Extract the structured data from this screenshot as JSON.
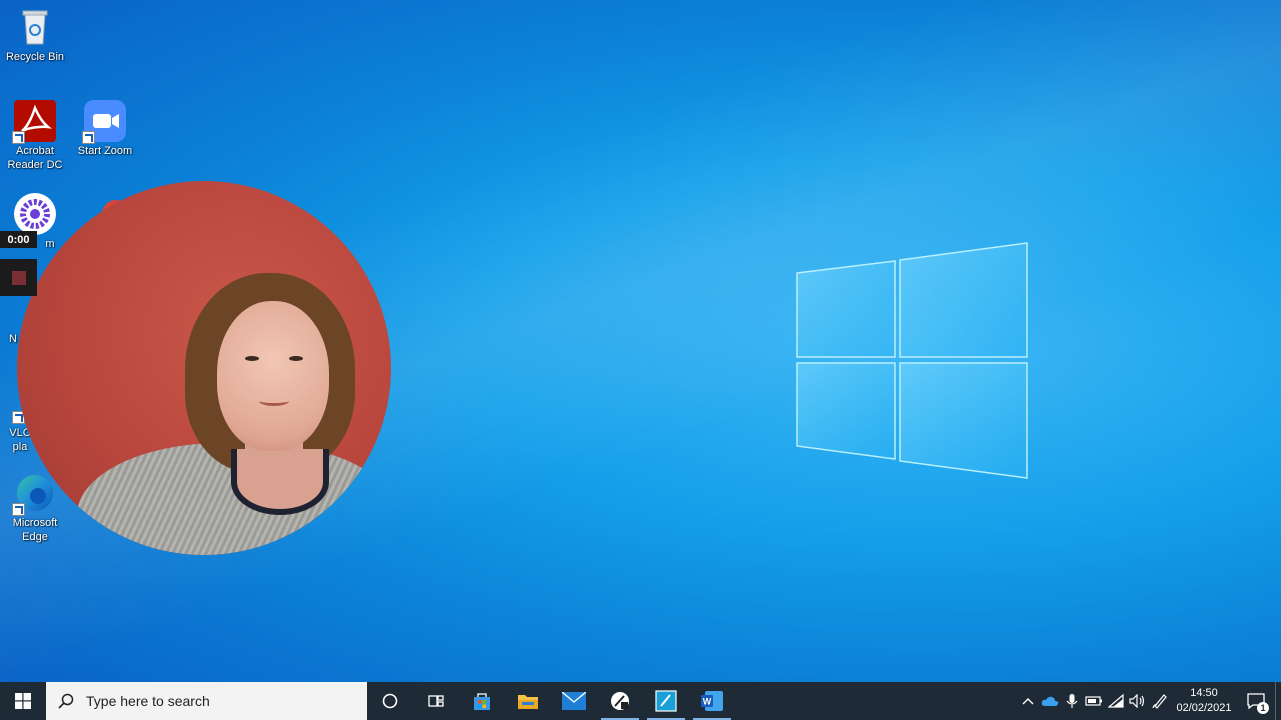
{
  "desktop": {
    "icons": {
      "recycle_bin": "Recycle Bin",
      "acrobat": "Acrobat\nReader DC",
      "start_zoom": "Start Zoom",
      "partial_app": "m",
      "partial_n": "N",
      "vlc": "VLC\npla",
      "edge": "Microsoft\nEdge"
    }
  },
  "recorder": {
    "timer": "0:00"
  },
  "taskbar": {
    "search_placeholder": "Type here to search",
    "apps": [
      "cortana-icon",
      "task-view-icon",
      "store-icon",
      "file-explorer-icon",
      "mail-icon",
      "snipping-icon",
      "notepad-icon",
      "word-icon"
    ],
    "clock_time": "14:50",
    "clock_date": "02/02/2021",
    "notification_count": "1"
  },
  "colors": {
    "taskbar": "#1e2a35",
    "accent": "#0078d7"
  }
}
